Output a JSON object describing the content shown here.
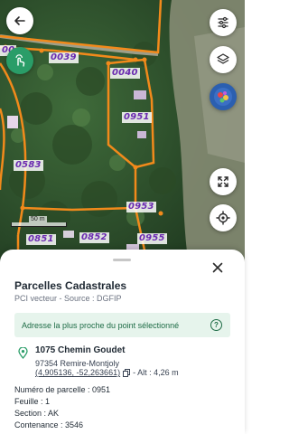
{
  "map": {
    "parcel_labels": [
      "0039",
      "0040",
      "0951",
      "0583",
      "0953",
      "0851",
      "0852",
      "0955",
      "00"
    ],
    "scale_label": "50 m"
  },
  "buttons": {
    "back_icon": "arrow-left-icon",
    "filter_icon": "sliders-icon",
    "layers_icon": "layers-icon",
    "touch_icon": "touch-hand-icon",
    "fullscreen_icon": "expand-icon",
    "locate_icon": "crosshair-icon"
  },
  "sheet": {
    "title": "Parcelles Cadastrales",
    "subtitle": "PCI vecteur - Source : DGFIP",
    "banner_text": "Adresse la plus proche du point sélectionné",
    "address": {
      "street": "1075 Chemin Goudet",
      "city": "97354 Remire-Montjoly",
      "coords": "(4,905136, -52,263661)",
      "altitude": "- Alt : 4,26 m"
    },
    "fields": {
      "numero": "Numéro de parcelle : 0951",
      "feuille": "Feuille : 1",
      "section": "Section : AK",
      "contenance": "Contenance : 3546"
    }
  },
  "colors": {
    "parcel_line": "#f28a1b",
    "parcel_label": "#6a2ab0",
    "accent_green": "#2a9d68",
    "banner_bg": "#e6f4ec"
  }
}
